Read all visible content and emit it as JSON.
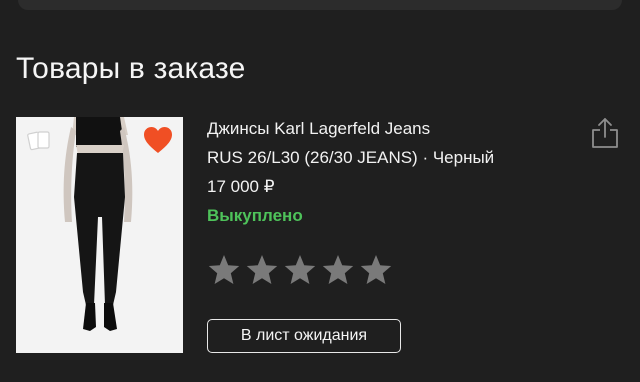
{
  "section": {
    "title": "Товары в заказе"
  },
  "item": {
    "name": "Джинсы Karl Lagerfeld Jeans",
    "variant": "RUS 26/L30 (26/30 JEANS) · Черный",
    "price": "17 000 ₽",
    "status": "Выкуплено",
    "status_color": "#4ec25a",
    "image_icons": [
      "compare-icon",
      "heart-icon"
    ],
    "favorite_color": "#f04f24",
    "rating": {
      "max": 5,
      "value": 0,
      "star_color": "#7a7a7a"
    },
    "wait_button_label": "В лист ожидания",
    "share_icon": "share-icon"
  }
}
